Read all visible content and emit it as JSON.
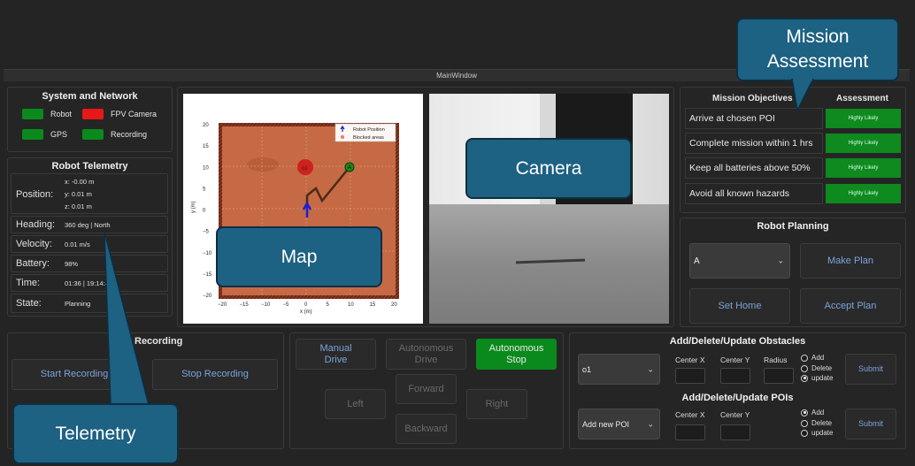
{
  "window_title": "MainWindow",
  "system": {
    "title": "System and Network",
    "items": [
      {
        "label": "Robot",
        "color": "#0a8a1c"
      },
      {
        "label": "FPV Camera",
        "color": "#e81818"
      },
      {
        "label": "GPS",
        "color": "#0a8a1c"
      },
      {
        "label": "Recording",
        "color": "#0a8a1c"
      }
    ]
  },
  "telemetry": {
    "title": "Robot Telemetry",
    "position_label": "Position:",
    "x": "x: -0.00 m",
    "y": "y: 0.01 m",
    "z": "z: 0.01 m",
    "heading_label": "Heading:",
    "heading": "360 deg | North",
    "velocity_label": "Velocity:",
    "velocity": "0.01 m/s",
    "battery_label": "Battery:",
    "battery": "98%",
    "time_label": "Time:",
    "time": "01:36 | 19:14:4",
    "state_label": "State:",
    "state": "Planning"
  },
  "map": {
    "legend_robot": "Robot Position",
    "legend_blocked": "Blocked areas",
    "xlabel": "x (m)",
    "ylabel": "y (m)",
    "ticks": [
      "−20",
      "−15",
      "−10",
      "−5",
      "0",
      "5",
      "10",
      "15",
      "20"
    ],
    "obstacle_label": "o1",
    "poi_label": "A"
  },
  "mission": {
    "title": "Mission Objectives",
    "assessment_title": "Assessment",
    "objectives": [
      {
        "text": "Arrive at chosen POI",
        "assessment": "Highly Likely"
      },
      {
        "text": "Complete mission within 1 hrs",
        "assessment": "Highly Likely"
      },
      {
        "text": "Keep all batteries above 50%",
        "assessment": "Highly Likely"
      },
      {
        "text": "Avoid all known hazards",
        "assessment": "Highly Likely"
      }
    ]
  },
  "planning": {
    "title": "Robot Planning",
    "selected": "A",
    "make_plan": "Make Plan",
    "set_home": "Set Home",
    "accept_plan": "Accept Plan"
  },
  "recording": {
    "title": "Recording",
    "start": "Start Recording",
    "stop": "Stop Recording"
  },
  "drive": {
    "manual": "Manual Drive",
    "autonomous": "Autonomous Drive",
    "stop": "Autonomous Stop",
    "forward": "Forward",
    "left": "Left",
    "right": "Right",
    "backward": "Backward"
  },
  "obstacles": {
    "title": "Add/Delete/Update Obstacles",
    "selected": "o1",
    "center_x": "Center X",
    "center_y": "Center Y",
    "radius": "Radius",
    "add": "Add",
    "delete": "Delete",
    "update": "update",
    "submit": "Submit"
  },
  "pois": {
    "title": "Add/Delete/Update POIs",
    "selected": "Add new POI",
    "center_x": "Center X",
    "center_y": "Center Y",
    "add": "Add",
    "delete": "Delete",
    "update": "update",
    "submit": "Submit"
  },
  "callouts": {
    "mission": "Mission Assessment",
    "camera": "Camera",
    "map": "Map",
    "telemetry": "Telemetry"
  }
}
